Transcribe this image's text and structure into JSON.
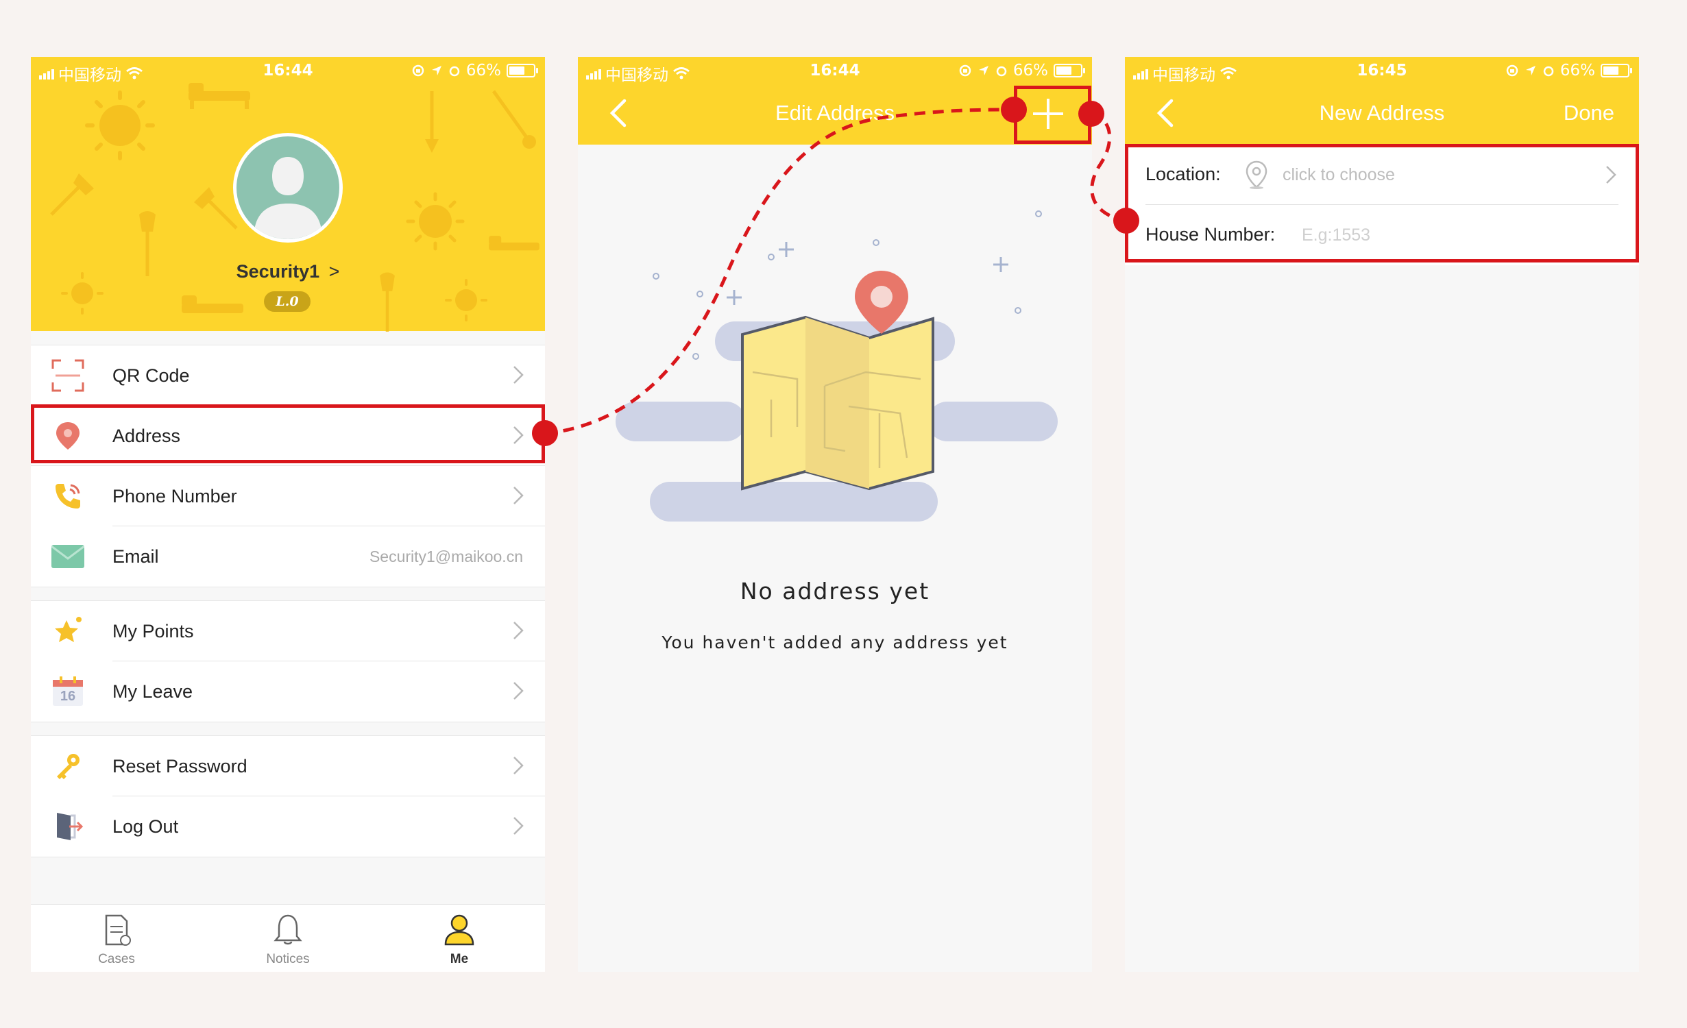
{
  "status_bar": {
    "carrier": "中国移动",
    "battery": "66%",
    "time_1": "16:44",
    "time_2": "16:44",
    "time_3": "16:45"
  },
  "profile": {
    "username": "Security1",
    "username_chevron": ">",
    "level": "L.0"
  },
  "menu": {
    "qr_code": "QR Code",
    "address": "Address",
    "phone_number": "Phone Number",
    "email": "Email",
    "email_value": "Security1@maikoo.cn",
    "my_points": "My Points",
    "my_leave": "My Leave",
    "calendar_day": "16",
    "reset_password": "Reset Password",
    "log_out": "Log Out"
  },
  "tabbar": {
    "cases": "Cases",
    "notices": "Notices",
    "me": "Me"
  },
  "edit_address": {
    "title": "Edit Address",
    "empty_title": "No address yet",
    "empty_subtitle": "You haven't added any address yet"
  },
  "new_address": {
    "title": "New Address",
    "done": "Done",
    "location_label": "Location:",
    "location_placeholder": "click to choose",
    "house_label": "House Number:",
    "house_placeholder": "E.g:1553"
  },
  "colors": {
    "accent_yellow": "#fdd52c",
    "highlight_red": "#d9161b",
    "pin_red": "#e8776a",
    "text_dark": "#222222"
  }
}
